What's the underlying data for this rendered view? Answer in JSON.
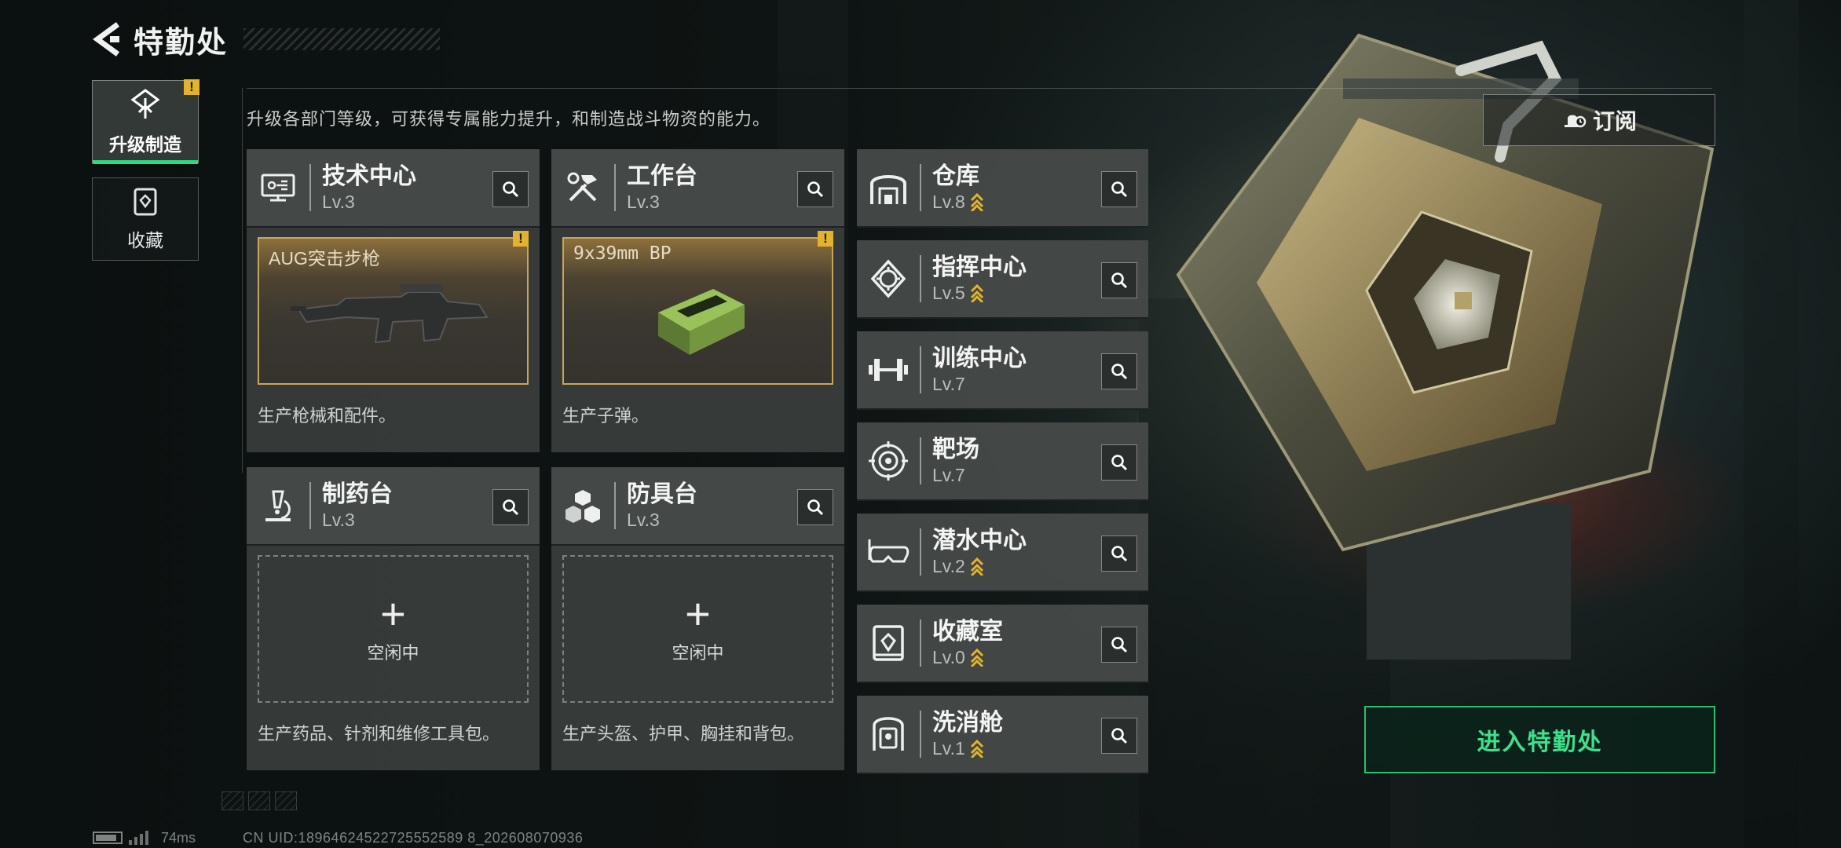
{
  "header": {
    "title": "特勤处"
  },
  "tabs": [
    {
      "label": "升级制造",
      "active": true,
      "alert": "!"
    },
    {
      "label": "收藏",
      "active": false
    }
  ],
  "description": "升级各部门等级，可获得专属能力提升，和制造战斗物资的能力。",
  "subscribe": {
    "label": "订阅",
    "icon": "bell-clock-icon"
  },
  "enter_button": {
    "label": "进入特勤处"
  },
  "production_cards": [
    {
      "title": "技术中心",
      "level": "Lv.3",
      "icon": "tech-center-icon",
      "slot": {
        "status": "producing",
        "item": "AUG突击步枪",
        "alert": "!"
      },
      "note": "生产枪械和配件。"
    },
    {
      "title": "工作台",
      "level": "Lv.3",
      "icon": "workbench-icon",
      "slot": {
        "status": "producing",
        "item": "9x39mm BP",
        "alert": "!"
      },
      "note": "生产子弹。"
    },
    {
      "title": "制药台",
      "level": "Lv.3",
      "icon": "pharmacy-icon",
      "slot": {
        "status": "idle",
        "plus": "+",
        "idle_text": "空闲中"
      },
      "note": "生产药品、针剂和维修工具包。"
    },
    {
      "title": "防具台",
      "level": "Lv.3",
      "icon": "armor-bench-icon",
      "slot": {
        "status": "idle",
        "plus": "+",
        "idle_text": "空闲中"
      },
      "note": "生产头盔、护甲、胸挂和背包。"
    }
  ],
  "facilities": [
    {
      "title": "仓库",
      "level": "Lv.8",
      "upgradable": true,
      "icon": "warehouse-icon"
    },
    {
      "title": "指挥中心",
      "level": "Lv.5",
      "upgradable": true,
      "icon": "command-center-icon"
    },
    {
      "title": "训练中心",
      "level": "Lv.7",
      "upgradable": false,
      "icon": "dumbbell-icon"
    },
    {
      "title": "靶场",
      "level": "Lv.7",
      "upgradable": false,
      "icon": "target-icon"
    },
    {
      "title": "潜水中心",
      "level": "Lv.2",
      "upgradable": true,
      "icon": "diving-mask-icon"
    },
    {
      "title": "收藏室",
      "level": "Lv.0",
      "upgradable": true,
      "icon": "collection-icon"
    },
    {
      "title": "洗消舱",
      "level": "Lv.1",
      "upgradable": true,
      "icon": "decon-chamber-icon"
    }
  ],
  "footer": {
    "ping": "74ms",
    "uid": "CN UID:18964624522725552589 8_202608070936"
  },
  "colors": {
    "accent_green": "#2fd97f",
    "alert_yellow": "#e3b32e",
    "slot_gold": "#c9a55b"
  }
}
